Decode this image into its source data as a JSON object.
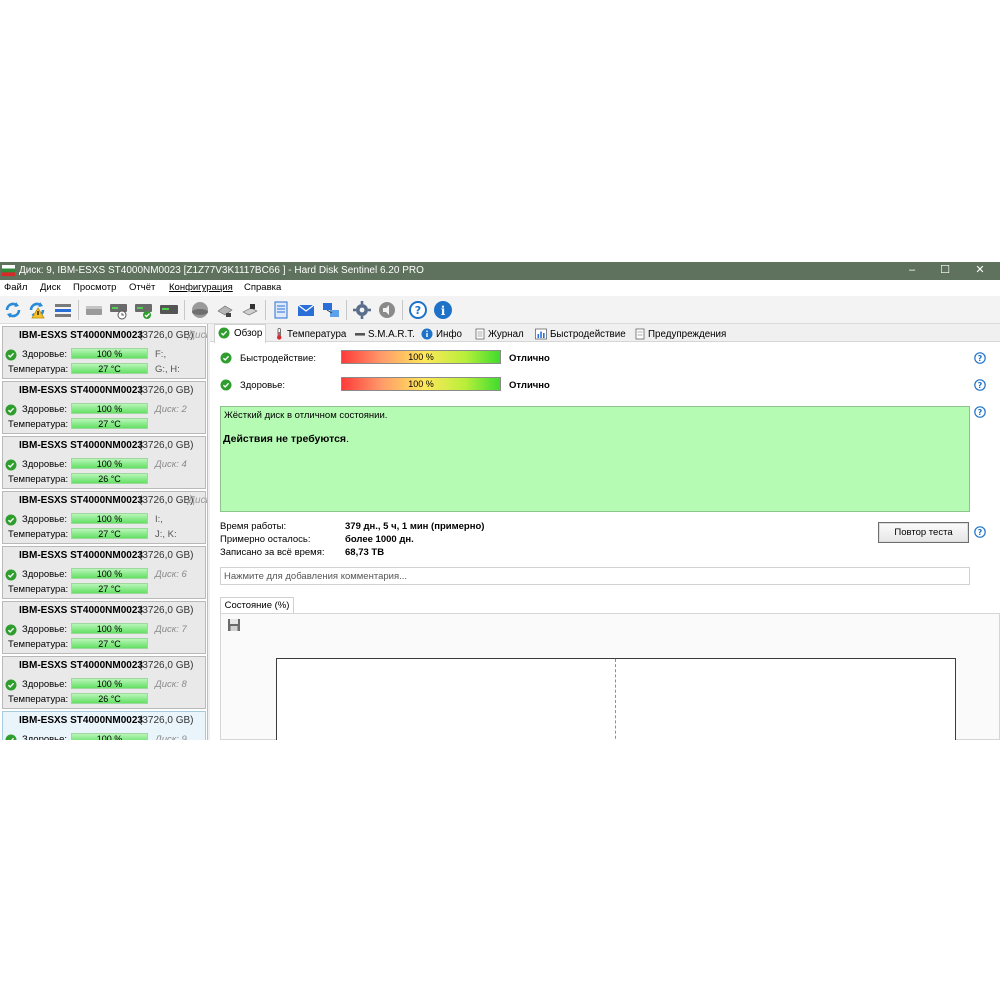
{
  "window": {
    "title": "Диск: 9, IBM-ESXS ST4000NM0023 [Z1Z77V3K1117BC66    ]  -  Hard Disk Sentinel 6.20 PRO",
    "minimize": "–",
    "maximize": "☐",
    "close": "✕"
  },
  "menu": [
    "Файл",
    "Диск",
    "Просмотр",
    "Отчёт",
    "Конфигурация",
    "Справка"
  ],
  "toolbar_icons": [
    "refresh-icon",
    "refresh-warning-icon",
    "disk-list-icon",
    "disk-grey-icon",
    "disk-clock-icon",
    "disk-check-icon",
    "disk-dark-icon",
    "sphere-icon",
    "usb-drive-icon",
    "usb-drive-icon-2",
    "report-icon",
    "mail-icon",
    "network-icon",
    "settings-icon",
    "speaker-icon",
    "help-icon",
    "info-icon"
  ],
  "disks": [
    {
      "name": "IBM-ESXS ST4000NM0023",
      "size": "(3726,0 GB)",
      "overflow": "Диск",
      "health_label": "Здоровье:",
      "health": "100 %",
      "temp_label": "Температура:",
      "temp": "27 °C",
      "ref1": "F:,",
      "ref2": "G:, H:",
      "ref_italic": false
    },
    {
      "name": "IBM-ESXS ST4000NM0023",
      "size": "(3726,0 GB)",
      "overflow": "",
      "health_label": "Здоровье:",
      "health": "100 %",
      "temp_label": "Температура:",
      "temp": "27 °C",
      "ref1": "Диск: 2",
      "ref2": "",
      "ref_italic": true
    },
    {
      "name": "IBM-ESXS ST4000NM0023",
      "size": "(3726,0 GB)",
      "overflow": "",
      "health_label": "Здоровье:",
      "health": "100 %",
      "temp_label": "Температура:",
      "temp": "26 °C",
      "ref1": "Диск: 4",
      "ref2": "",
      "ref_italic": true
    },
    {
      "name": "IBM-ESXS ST4000NM0023",
      "size": "(3726,0 GB)",
      "overflow": "Диск",
      "health_label": "Здоровье:",
      "health": "100 %",
      "temp_label": "Температура:",
      "temp": "27 °C",
      "ref1": "I:,",
      "ref2": "J:, K:",
      "ref_italic": false
    },
    {
      "name": "IBM-ESXS ST4000NM0023",
      "size": "(3726,0 GB)",
      "overflow": "",
      "health_label": "Здоровье:",
      "health": "100 %",
      "temp_label": "Температура:",
      "temp": "27 °C",
      "ref1": "Диск: 6",
      "ref2": "",
      "ref_italic": true
    },
    {
      "name": "IBM-ESXS ST4000NM0023",
      "size": "(3726,0 GB)",
      "overflow": "",
      "health_label": "Здоровье:",
      "health": "100 %",
      "temp_label": "Температура:",
      "temp": "27 °C",
      "ref1": "Диск: 7",
      "ref2": "",
      "ref_italic": true
    },
    {
      "name": "IBM-ESXS ST4000NM0023",
      "size": "(3726,0 GB)",
      "overflow": "",
      "health_label": "Здоровье:",
      "health": "100 %",
      "temp_label": "Температура:",
      "temp": "26 °C",
      "ref1": "Диск: 8",
      "ref2": "",
      "ref_italic": true
    },
    {
      "name": "IBM-ESXS ST4000NM0023",
      "size": "(3726,0 GB)",
      "overflow": "",
      "health_label": "Здоровье:",
      "health": "100 %",
      "temp_label": "",
      "temp": "",
      "ref1": "Диск: 9",
      "ref2": "",
      "ref_italic": true
    }
  ],
  "tabs": [
    {
      "label": "Обзор",
      "icon": "check-circle-icon"
    },
    {
      "label": "Температура",
      "icon": "thermometer-icon"
    },
    {
      "label": "S.M.A.R.T.",
      "icon": "smart-icon"
    },
    {
      "label": "Инфо",
      "icon": "info-icon"
    },
    {
      "label": "Журнал",
      "icon": "journal-icon"
    },
    {
      "label": "Быстродействие",
      "icon": "performance-icon"
    },
    {
      "label": "Предупреждения",
      "icon": "warning-icon"
    }
  ],
  "overview": {
    "performance_label": "Быстродействие:",
    "performance_value": "100 %",
    "performance_fraction": 1.0,
    "performance_rating": "Отлично",
    "health_label": "Здоровье:",
    "health_value": "100 %",
    "health_fraction": 1.0,
    "health_rating": "Отлично",
    "status_line1": "Жёсткий диск в отличном состоянии.",
    "status_line2_bold": "Действия не требуются",
    "status_line2_end": ".",
    "uptime_label": "Время работы:",
    "uptime_value": "379 дн., 5 ч, 1 мин (примерно)",
    "remaining_label": "Примерно осталось:",
    "remaining_value": "более 1000 дн.",
    "written_label": "Записано за всё время:",
    "written_value": "68,73 TB",
    "retest_button": "Повтор теста",
    "comment_placeholder": "Нажмите для добавления комментария..."
  },
  "chart_tab": "Состояние (%)",
  "colors": {
    "titlebar": "#5f725e",
    "status_box": "#b6fbb4",
    "health_bar": "#64e064",
    "check": "#2f9e2f",
    "help": "#1e73c8"
  }
}
